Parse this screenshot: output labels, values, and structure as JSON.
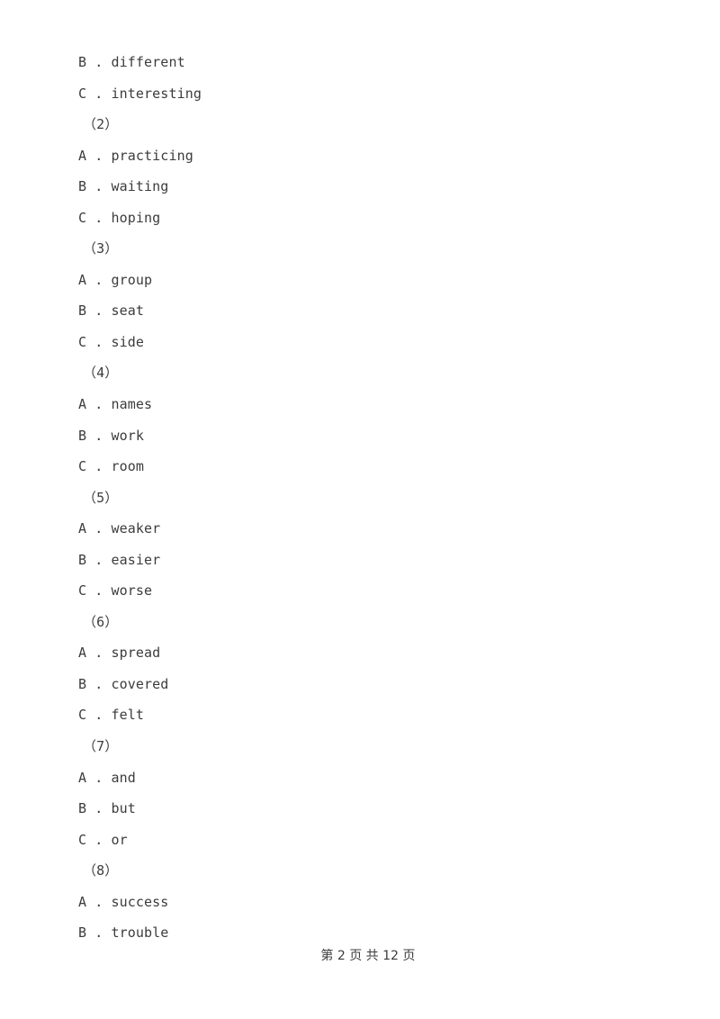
{
  "page": {
    "background_color": "#ffffff",
    "text_color": "#3c3c3c"
  },
  "document": {
    "lines": [
      {
        "kind": "option",
        "text": "B . different"
      },
      {
        "kind": "option",
        "text": "C . interesting"
      },
      {
        "kind": "question",
        "text": "（2）"
      },
      {
        "kind": "option",
        "text": "A . practicing"
      },
      {
        "kind": "option",
        "text": "B . waiting"
      },
      {
        "kind": "option",
        "text": "C . hoping"
      },
      {
        "kind": "question",
        "text": "（3）"
      },
      {
        "kind": "option",
        "text": "A . group"
      },
      {
        "kind": "option",
        "text": "B . seat"
      },
      {
        "kind": "option",
        "text": "C . side"
      },
      {
        "kind": "question",
        "text": "（4）"
      },
      {
        "kind": "option",
        "text": "A . names"
      },
      {
        "kind": "option",
        "text": "B . work"
      },
      {
        "kind": "option",
        "text": "C . room"
      },
      {
        "kind": "question",
        "text": "（5）"
      },
      {
        "kind": "option",
        "text": "A . weaker"
      },
      {
        "kind": "option",
        "text": "B . easier"
      },
      {
        "kind": "option",
        "text": "C . worse"
      },
      {
        "kind": "question",
        "text": "（6）"
      },
      {
        "kind": "option",
        "text": "A . spread"
      },
      {
        "kind": "option",
        "text": "B . covered"
      },
      {
        "kind": "option",
        "text": "C . felt"
      },
      {
        "kind": "question",
        "text": "（7）"
      },
      {
        "kind": "option",
        "text": "A . and"
      },
      {
        "kind": "option",
        "text": "B . but"
      },
      {
        "kind": "option",
        "text": "C . or"
      },
      {
        "kind": "question",
        "text": "（8）"
      },
      {
        "kind": "option",
        "text": "A . success"
      },
      {
        "kind": "option",
        "text": "B . trouble"
      }
    ]
  },
  "footer": {
    "text": "第 2 页 共 12 页",
    "current_page": "2",
    "total_pages": "12"
  }
}
